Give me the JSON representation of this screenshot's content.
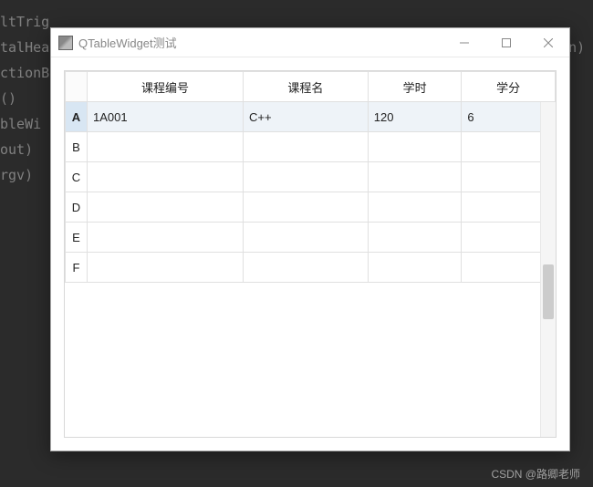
{
  "codeBg": {
    "lines": [
      "",
      "ltTrig",
      "",
      "talHea                                                               n)",
      "",
      "ctionB",
      "()",
      "bleWi",
      "out)",
      "",
      "",
      "",
      "",
      "",
      "",
      "",
      "rgv)"
    ]
  },
  "window": {
    "title": "QTableWidget测试"
  },
  "table": {
    "headers": [
      "课程编号",
      "课程名",
      "学时",
      "学分"
    ],
    "rowHeaders": [
      "A",
      "B",
      "C",
      "D",
      "E",
      "F"
    ],
    "rows": [
      {
        "cells": [
          "1A001",
          "C++",
          "120",
          "6"
        ],
        "selected": true
      },
      {
        "cells": [
          "",
          "",
          "",
          ""
        ],
        "selected": false
      },
      {
        "cells": [
          "",
          "",
          "",
          ""
        ],
        "selected": false
      },
      {
        "cells": [
          "",
          "",
          "",
          ""
        ],
        "selected": false
      },
      {
        "cells": [
          "",
          "",
          "",
          ""
        ],
        "selected": false
      },
      {
        "cells": [
          "",
          "",
          "",
          ""
        ],
        "selected": false
      }
    ]
  },
  "watermark": "CSDN @路卿老师"
}
